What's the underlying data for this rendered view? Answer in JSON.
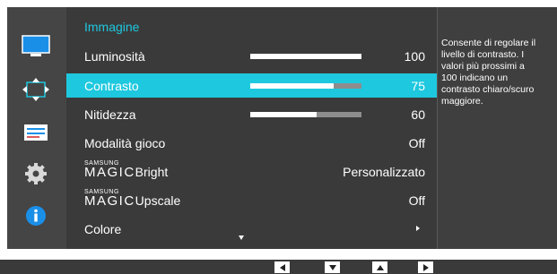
{
  "menu": {
    "title": "Immagine",
    "items": [
      {
        "label": "Luminosità",
        "value": "100",
        "level": 1.0
      },
      {
        "label": "Contrasto",
        "value": "75",
        "level": 0.75
      },
      {
        "label": "Nitidezza",
        "value": "60",
        "level": 0.6
      },
      {
        "label": "Modalità gioco",
        "value": "Off"
      },
      {
        "label_prefix": "SAMSUNG",
        "label_magic": "MAGIC",
        "label": "Bright",
        "value": "Personalizzato"
      },
      {
        "label_prefix": "SAMSUNG",
        "label_magic": "MAGIC",
        "label": "Upscale",
        "value": "Off"
      },
      {
        "label": "Colore",
        "value": ""
      }
    ],
    "selected_index": 1
  },
  "help": {
    "lines": [
      "Consente di regolare il",
      "livello di contrasto. I",
      "valori più prossimi a",
      "100 indicano un",
      "contrasto chiaro/scuro",
      "maggiore."
    ]
  },
  "sidebar": {
    "icons": [
      "picture-icon",
      "screen-position-icon",
      "system-settings-icon",
      "gear-icon",
      "info-icon"
    ]
  },
  "nav": {
    "keys": [
      "left-arrow-icon",
      "down-arrow-icon",
      "up-arrow-icon",
      "right-arrow-icon"
    ]
  },
  "colors": {
    "accent": "#1ec8df",
    "background": "#3a3a3a",
    "text": "#ffffff",
    "bar_track": "#8d8d8d"
  }
}
